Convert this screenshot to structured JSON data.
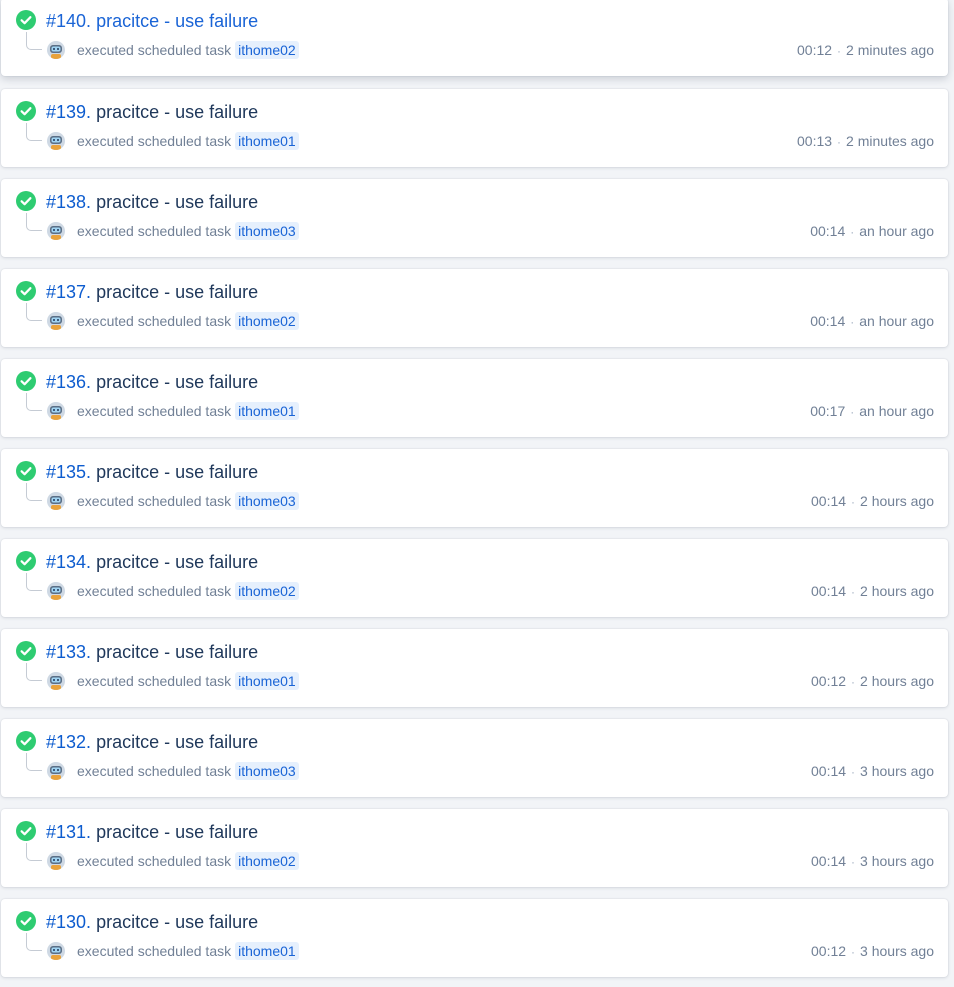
{
  "colors": {
    "success": "#2ecc71",
    "link": "#0d5ccf",
    "title": "#1e375a",
    "muted": "#718096",
    "badge_bg": "#e6f0fd"
  },
  "icons": {
    "status": "check-circle-icon",
    "avatar": "robot-avatar-icon"
  },
  "builds": [
    {
      "number": "#140.",
      "title": "pracitce - use failure",
      "status": "success",
      "action": "executed scheduled task",
      "task": "ithome02",
      "duration": "00:12",
      "sep": "·",
      "ago": "2 minutes ago",
      "active": true
    },
    {
      "number": "#139.",
      "title": "pracitce - use failure",
      "status": "success",
      "action": "executed scheduled task",
      "task": "ithome01",
      "duration": "00:13",
      "sep": "·",
      "ago": "2 minutes ago",
      "active": false
    },
    {
      "number": "#138.",
      "title": "pracitce - use failure",
      "status": "success",
      "action": "executed scheduled task",
      "task": "ithome03",
      "duration": "00:14",
      "sep": "·",
      "ago": "an hour ago",
      "active": false
    },
    {
      "number": "#137.",
      "title": "pracitce - use failure",
      "status": "success",
      "action": "executed scheduled task",
      "task": "ithome02",
      "duration": "00:14",
      "sep": "·",
      "ago": "an hour ago",
      "active": false
    },
    {
      "number": "#136.",
      "title": "pracitce - use failure",
      "status": "success",
      "action": "executed scheduled task",
      "task": "ithome01",
      "duration": "00:17",
      "sep": "·",
      "ago": "an hour ago",
      "active": false
    },
    {
      "number": "#135.",
      "title": "pracitce - use failure",
      "status": "success",
      "action": "executed scheduled task",
      "task": "ithome03",
      "duration": "00:14",
      "sep": "·",
      "ago": "2 hours ago",
      "active": false
    },
    {
      "number": "#134.",
      "title": "pracitce - use failure",
      "status": "success",
      "action": "executed scheduled task",
      "task": "ithome02",
      "duration": "00:14",
      "sep": "·",
      "ago": "2 hours ago",
      "active": false
    },
    {
      "number": "#133.",
      "title": "pracitce - use failure",
      "status": "success",
      "action": "executed scheduled task",
      "task": "ithome01",
      "duration": "00:12",
      "sep": "·",
      "ago": "2 hours ago",
      "active": false
    },
    {
      "number": "#132.",
      "title": "pracitce - use failure",
      "status": "success",
      "action": "executed scheduled task",
      "task": "ithome03",
      "duration": "00:14",
      "sep": "·",
      "ago": "3 hours ago",
      "active": false
    },
    {
      "number": "#131.",
      "title": "pracitce - use failure",
      "status": "success",
      "action": "executed scheduled task",
      "task": "ithome02",
      "duration": "00:14",
      "sep": "·",
      "ago": "3 hours ago",
      "active": false
    },
    {
      "number": "#130.",
      "title": "pracitce - use failure",
      "status": "success",
      "action": "executed scheduled task",
      "task": "ithome01",
      "duration": "00:12",
      "sep": "·",
      "ago": "3 hours ago",
      "active": false
    }
  ]
}
